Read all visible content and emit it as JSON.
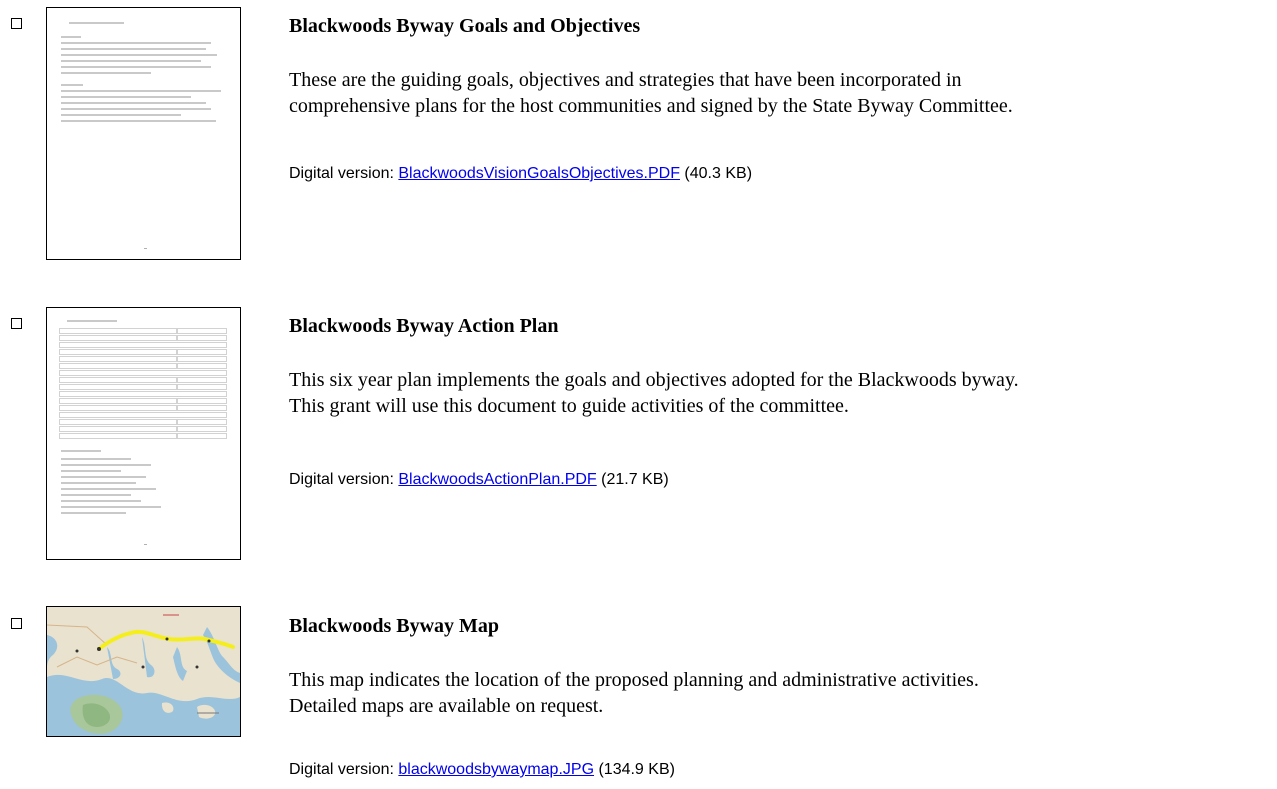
{
  "items": [
    {
      "title": "Blackwoods Byway Goals and Objectives",
      "desc_line1": "These are the guiding goals, objectives and strategies that have been incorporated in",
      "desc_line2": "comprehensive plans for the host communities and signed by the State Byway Committee.",
      "dv_prefix": "Digital version: ",
      "link": "BlackwoodsVisionGoalsObjectives.PDF",
      "size": " (40.3 KB)",
      "thumb_icon": "document-page-thumbnail-icon"
    },
    {
      "title": "Blackwoods Byway Action Plan",
      "desc_line1": "This six year plan implements the goals and objectives adopted for the Blackwoods byway.",
      "desc_line2": "This grant will use this document to guide activities of the committee.",
      "dv_prefix": "Digital version: ",
      "link": "BlackwoodsActionPlan.PDF",
      "size": " (21.7 KB)",
      "thumb_icon": "table-document-thumbnail-icon"
    },
    {
      "title": "Blackwoods Byway Map",
      "desc_line1": "This map indicates the location of the proposed planning and administrative activities.",
      "desc_line2": "Detailed maps are available on request.",
      "dv_prefix": "Digital version: ",
      "link": "blackwoodsbywaymap.JPG",
      "size": " (134.9 KB)",
      "thumb_icon": "map-thumbnail-icon"
    }
  ],
  "colors": {
    "link": "#0000ee",
    "map_route": "#f4ef1c",
    "map_water": "#9cc3dc",
    "map_land": "#e9e2cf"
  }
}
